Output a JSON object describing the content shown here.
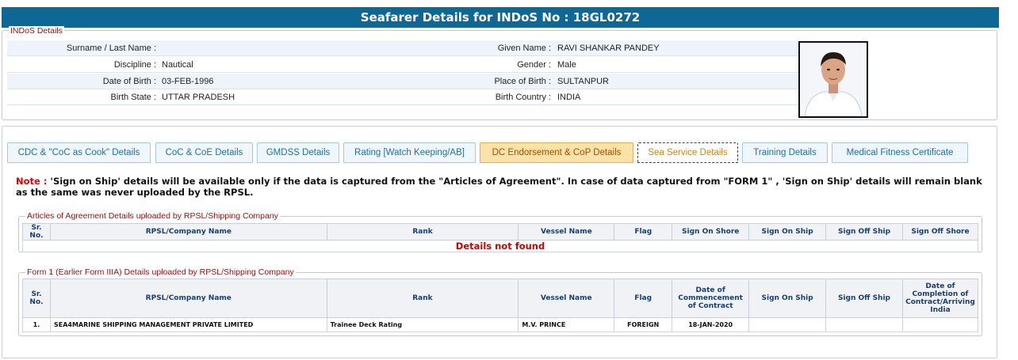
{
  "page": {
    "title": "Seafarer Details for INDoS No : 18GL0272"
  },
  "indos": {
    "legend": "INDoS Details",
    "rows": [
      {
        "l1": "Surname / Last Name :",
        "v1": "",
        "l2": "Given Name :",
        "v2": "RAVI SHANKAR PANDEY"
      },
      {
        "l1": "Discipline :",
        "v1": "Nautical",
        "l2": "Gender :",
        "v2": "Male"
      },
      {
        "l1": "Date of Birth :",
        "v1": "03-FEB-1996",
        "l2": "Place of Birth :",
        "v2": "SULTANPUR"
      },
      {
        "l1": "Birth State :",
        "v1": "UTTAR PRADESH",
        "l2": "Birth Country :",
        "v2": "INDIA"
      }
    ]
  },
  "tabs": [
    {
      "label": "CDC & \"CoC as Cook\" Details",
      "state": "normal"
    },
    {
      "label": "CoC & CoE Details",
      "state": "normal"
    },
    {
      "label": "GMDSS Details",
      "state": "normal"
    },
    {
      "label": "Rating [Watch Keeping/AB]",
      "state": "normal"
    },
    {
      "label": "DC Endorsement & CoP Details",
      "state": "orange"
    },
    {
      "label": "Sea Service Details",
      "state": "active"
    },
    {
      "label": "Training Details",
      "state": "normal"
    },
    {
      "label": "Medical Fitness Certificate",
      "state": "normal"
    }
  ],
  "note": {
    "prefix": "Note : ",
    "text": "'Sign on Ship' details will be available only if the data is captured from the \"Articles of Agreement\". In case of data captured from \"FORM 1\" , 'Sign on Ship' details will remain blank as the same was never uploaded by the RPSL."
  },
  "articles": {
    "legend": "Articles of Agreement Details uploaded by RPSL/Shipping Company",
    "headers": [
      "Sr. No.",
      "RPSL/Company Name",
      "Rank",
      "Vessel Name",
      "Flag",
      "Sign On Shore",
      "Sign On Ship",
      "Sign Off Ship",
      "Sign Off Shore"
    ],
    "empty_message": "Details not found"
  },
  "form1": {
    "legend": "Form 1 (Earlier Form IIIA) Details uploaded by RPSL/Shipping Company",
    "headers": [
      "Sr. No.",
      "RPSL/Company Name",
      "Rank",
      "Vessel Name",
      "Flag",
      "Date of Commencement of Contract",
      "Sign On Ship",
      "Sign Off Ship",
      "Date of Completion of Contract/Arriving India"
    ],
    "rows": [
      [
        "1.",
        "SEA4MARINE SHIPPING MANAGEMENT PRIVATE LIMITED",
        "Trainee Deck Rating",
        "M.V. PRINCE",
        "FOREIGN",
        "18-JAN-2020",
        "",
        "",
        ""
      ]
    ]
  },
  "colors": {
    "header_bar": "#0f6796",
    "legend": "#a01010",
    "note_red": "#e00000",
    "tab_link": "#1d6fa6",
    "tab_active_text": "#d4860e"
  }
}
